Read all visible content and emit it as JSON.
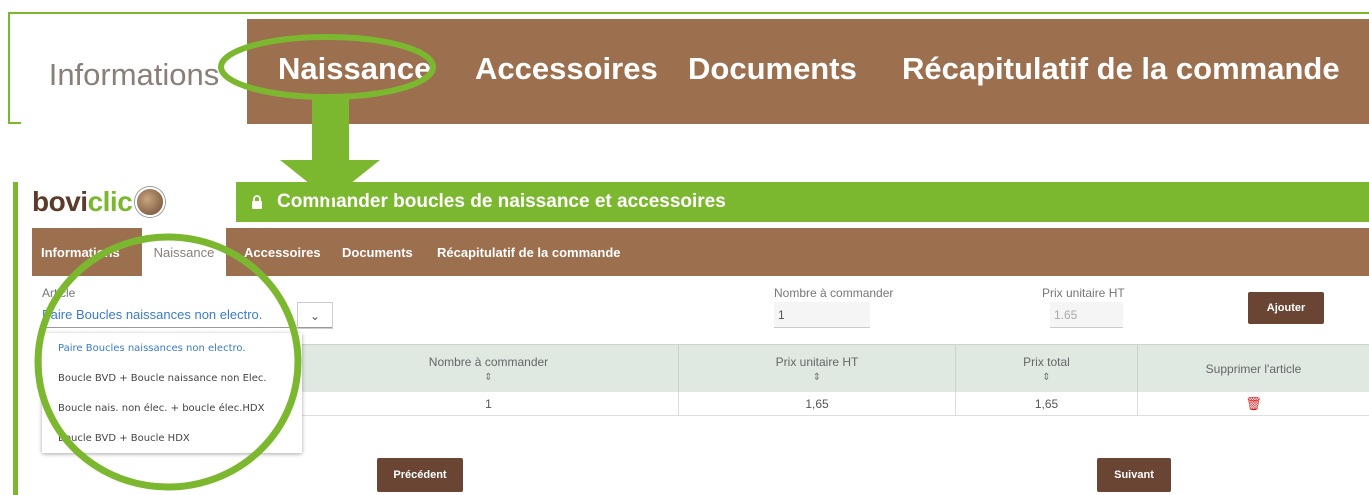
{
  "zoom_tabs": [
    "Informations",
    "Naissance",
    "Accessoires",
    "Documents",
    "Récapitulatif de la commande"
  ],
  "app": {
    "logo": {
      "part1": "bovi",
      "part2": "clic"
    },
    "title": "Commander boucles de naissance et accessoires",
    "tabs": [
      "Informations",
      "Naissance",
      "Accessoires",
      "Documents",
      "Récapitulatif de la commande"
    ],
    "active_tab": "Naissance",
    "form": {
      "article_label": "Article",
      "article_value": "Paire Boucles naissances non electro.",
      "quantity_label": "Nombre à commander",
      "quantity_value": "1",
      "unit_price_label": "Prix unitaire HT",
      "unit_price_value": "1.65",
      "add_button": "Ajouter"
    },
    "dropdown_options": [
      "Paire Boucles naissances non electro.",
      "Boucle BVD + Boucle naissance non Elec.",
      "Boucle nais. non élec. + boucle élec.HDX",
      "Boucle BVD + Boucle HDX"
    ],
    "table": {
      "headers": [
        "Nombre à commander",
        "Prix unitaire HT",
        "Prix total",
        "Supprimer l'article"
      ],
      "rows": [
        {
          "quantity": "1",
          "unit_price": "1,65",
          "total": "1,65"
        }
      ]
    },
    "prev_button": "Précédent",
    "next_button": "Suivant"
  },
  "colors": {
    "tab_bar": "#9c6f4e",
    "accent_green": "#7cb82f",
    "button_brown": "#6b4533",
    "link_blue": "#3a7bc8",
    "delete_red": "#d61f1f"
  },
  "icons": [
    "lock-icon",
    "chevron-down-icon",
    "sort-icon",
    "trash-icon",
    "cow-logo-icon"
  ]
}
